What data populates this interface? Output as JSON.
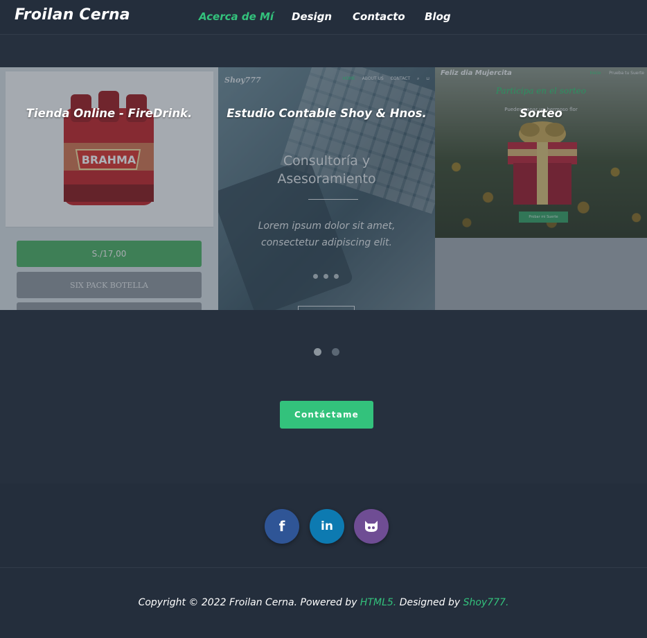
{
  "header": {
    "brand": "Froilan Cerna",
    "nav": [
      {
        "label": "Acerca de Mí"
      },
      {
        "label": "Design"
      },
      {
        "label": "Contacto"
      },
      {
        "label": "Blog"
      }
    ]
  },
  "portfolio": {
    "tiles": [
      {
        "title": "Tienda Online - FireDrink.",
        "price": "S./17,00",
        "variant": "SIX PACK BOTELLA",
        "product_label": "BRAHMA"
      },
      {
        "title": "Estudio Contable Shoy & Hnos.",
        "logo": "Shoy777",
        "menu": [
          "HOME",
          "ABOUT US",
          "CONTACT"
        ],
        "headline_1": "Consultoría y",
        "headline_2": "Asesoramiento",
        "lorem_1": "Lorem ipsum dolor sit amet,",
        "lorem_2": "consectetur adipiscing elit."
      },
      {
        "title": "Sorteo",
        "top_title": "Feliz dia Mujercita",
        "links": [
          "Inicio",
          "Prueba tu Suerte"
        ],
        "tagline": "Participa en el sorteo",
        "sub": "Puedes ganar un hermoso flor",
        "button": "Probar mi Suerte"
      }
    ]
  },
  "carousel": {
    "dots": 2,
    "active": 0
  },
  "cta": {
    "label": "Contáctame"
  },
  "social": [
    {
      "name": "facebook",
      "icon": "facebook-icon",
      "glyph": "f",
      "color": "#2f5596"
    },
    {
      "name": "linkedin",
      "icon": "linkedin-icon",
      "glyph": "in",
      "color": "#0d7ab1"
    },
    {
      "name": "github",
      "icon": "github-icon",
      "glyph": "",
      "color": "#6f4d94"
    }
  ],
  "footer": {
    "prefix": "Copyright © 2022 Froilan Cerna. Powered by ",
    "powered": "HTML5.",
    "middle": " Designed by ",
    "designed": "Shoy777."
  },
  "colors": {
    "accent": "#33c27c",
    "background": "#26303e",
    "header": "#242e3c"
  }
}
